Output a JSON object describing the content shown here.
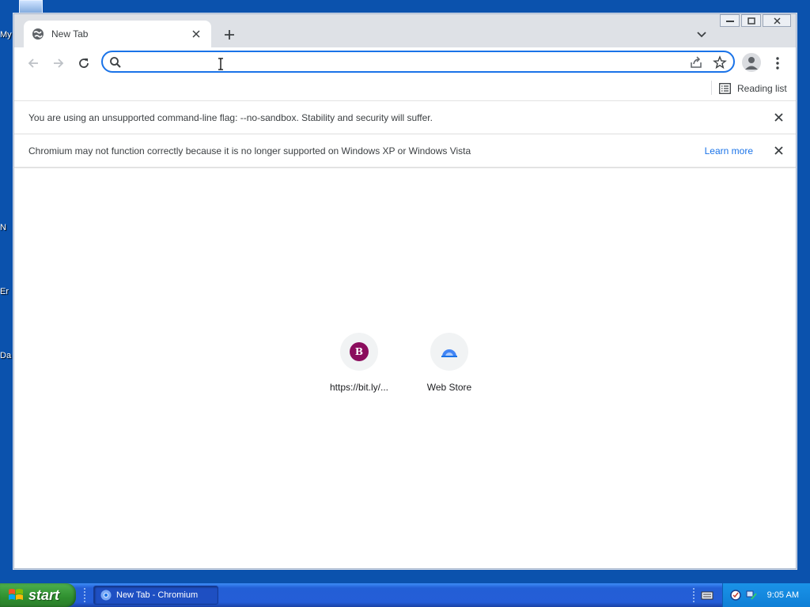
{
  "desktop": {
    "fragments": [
      "My",
      "N",
      "Er",
      "Da"
    ]
  },
  "browser": {
    "tab": {
      "title": "New Tab"
    },
    "omnibox": {
      "value": "",
      "placeholder": ""
    },
    "bookmarks": {
      "reading_list_label": "Reading list"
    },
    "infobars": [
      {
        "message": "You are using an unsupported command-line flag: --no-sandbox. Stability and security will suffer.",
        "link": ""
      },
      {
        "message": "Chromium may not function correctly because it is no longer supported on Windows XP or Windows Vista",
        "link": "Learn more"
      }
    ],
    "shortcuts": [
      {
        "label": "https://bit.ly/...",
        "letter": "B",
        "color": "#8b0d5d"
      },
      {
        "label": "Web Store",
        "letter": "",
        "color": "#4285f4"
      }
    ],
    "accent": "#1a73e8"
  },
  "taskbar": {
    "start_label": "start",
    "task_item": "New Tab - Chromium",
    "clock": "9:05 AM"
  }
}
